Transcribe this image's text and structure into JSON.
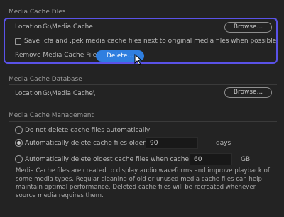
{
  "media_cache_files": {
    "title": "Media Cache Files",
    "location_label": "Location:",
    "location_value": "G:\\Media Cache",
    "browse_label": "Browse...",
    "save_option_label": "Save .cfa and .pek media cache files next to original media files when possible",
    "remove_label": "Remove Media Cache Files",
    "delete_label": "Delete..."
  },
  "media_cache_database": {
    "title": "Media Cache Database",
    "location_label": "Location:",
    "location_value": "G:\\Media Cache\\",
    "browse_label": "Browse..."
  },
  "media_cache_management": {
    "title": "Media Cache Management",
    "options": [
      {
        "label": "Do not delete cache files automatically",
        "selected": false
      },
      {
        "label": "Automatically delete cache files older than:",
        "selected": true,
        "value": "90",
        "unit": "days"
      },
      {
        "label": "Automatically delete oldest cache files when cache exceeds:",
        "selected": false,
        "value": "60",
        "unit": "GB"
      }
    ],
    "description": "Media Cache files are created to display audio waveforms and improve playback of some media types.  Regular cleaning of old or unused media cache files can help maintain optimal performance. Deleted cache files will be recreated whenever source media requires them."
  },
  "colors": {
    "background": "#232323",
    "accent_primary": "#2f7fe0",
    "highlight_border": "#5a52e8"
  }
}
